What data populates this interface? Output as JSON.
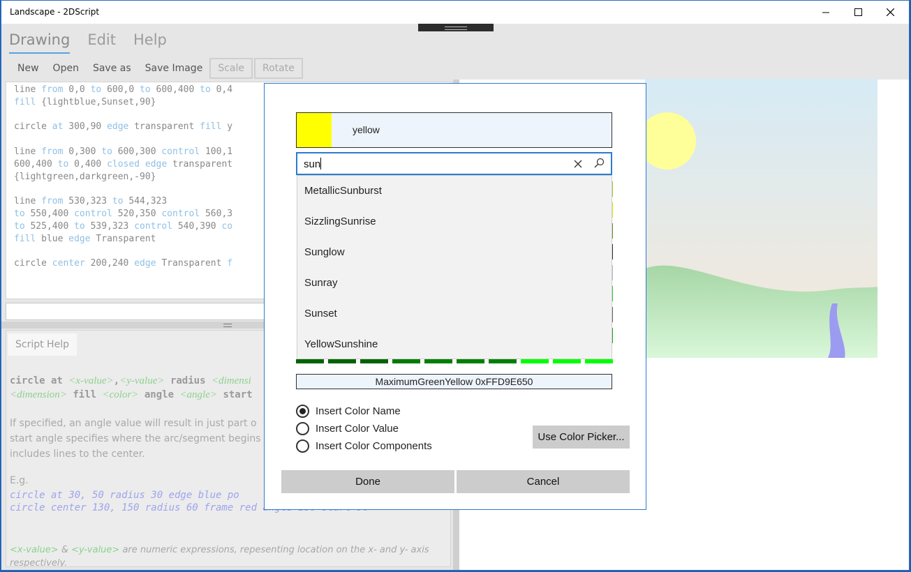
{
  "window": {
    "title": "Landscape - 2DScript"
  },
  "menu_tabs": [
    {
      "label": "Drawing",
      "active": true
    },
    {
      "label": "Edit",
      "active": false
    },
    {
      "label": "Help",
      "active": false
    }
  ],
  "toolbar": {
    "new": "New",
    "open": "Open",
    "save_as": "Save as",
    "save_image": "Save Image",
    "scale": "Scale",
    "rotate": "Rotate"
  },
  "editor": {
    "line1a": "line ",
    "line1b": "from",
    "line1c": " 0,0 ",
    "line1d": "to",
    "line1e": " 600,0 ",
    "line1f": "to",
    "line1g": " 600,400 ",
    "line1h": "to",
    "line1i": " 0,4",
    "line2a": "fill",
    "line2b": " {lightblue,Sunset,90}",
    "line3a": "circle ",
    "line3b": "at",
    "line3c": " 300,90 ",
    "line3d": "edge",
    "line3e": " transparent ",
    "line3f": "fill",
    "line3g": " y",
    "line4a": "line ",
    "line4b": "from",
    "line4c": " 0,300 ",
    "line4d": "to",
    "line4e": " 600,300 ",
    "line4f": "control",
    "line4g": " 100,1",
    "line5a": "600,400 ",
    "line5b": "to",
    "line5c": " 0,400 ",
    "line5d": "closed",
    "line5e": " ",
    "line5f": "edge",
    "line5g": " transparent",
    "line6": "{lightgreen,darkgreen,-90}",
    "line7a": "line ",
    "line7b": "from",
    "line7c": " 530,323 ",
    "line7d": "to",
    "line7e": " 544,323",
    "line8a": "to",
    "line8b": " 550,400 ",
    "line8c": "control",
    "line8d": " 520,350 ",
    "line8e": "control",
    "line8f": " 560,3",
    "line9a": "to",
    "line9b": " 525,400 ",
    "line9c": "to",
    "line9d": " 539,323 ",
    "line9e": "control",
    "line9f": " 540,390 ",
    "line9g": "co",
    "line10a": "fill",
    "line10b": " blue ",
    "line10c": "edge",
    "line10d": " Transparent",
    "line11a": "circle ",
    "line11b": "center",
    "line11c": " 200,240 ",
    "line11d": "edge",
    "line11e": " Transparent ",
    "line11f": "f"
  },
  "help": {
    "tab_label": "Script Help",
    "syntax1a": "circle at ",
    "syntax1b": "<x-value>",
    "syntax1c": ",",
    "syntax1d": "<y-value>",
    "syntax1e": " radius ",
    "syntax1f": "<dimensi",
    "syntax2a": "<dimension>",
    "syntax2b": " fill ",
    "syntax2c": "<color>",
    "syntax2d": " angle ",
    "syntax2e": "<angle>",
    "syntax2f": " start",
    "para1": "If specified, an angle value will result in  just part o",
    "para2": "start angle specifies where the arc/segment begins",
    "para3": "includes lines to the center.",
    "eg_label": "E.g.",
    "code1": "circle at 30, 50 radius 30 edge blue po",
    "code2": "circle center 130, 150 radius 60 frame red angle 180 start 90",
    "foot_a": "<x-value>",
    "foot_b": " & ",
    "foot_c": "<y-value>",
    "foot_d": " are numeric expressions, repesenting location on the x- and y- axis respectively."
  },
  "dialog": {
    "selected_color_name": "yellow",
    "selected_color": "#ffff00",
    "search_value": "sun",
    "suggestions": [
      "MetallicSunburst",
      "SizzlingSunrise",
      "Sunglow",
      "Sunray",
      "Sunset",
      "YellowSunshine"
    ],
    "hover_info": "MaximumGreenYellow 0xFFD9E650",
    "options": [
      {
        "label": "Insert Color Name",
        "selected": true
      },
      {
        "label": "Insert Color Value",
        "selected": false
      },
      {
        "label": "Insert Color Components",
        "selected": false
      }
    ],
    "color_picker_button": "Use Color Picker...",
    "done_button": "Done",
    "cancel_button": "Cancel",
    "swatch_colors": [
      "#006400",
      "#006400",
      "#006400",
      "#007a00",
      "#007f00",
      "#008000",
      "#008000",
      "#00ff00",
      "#00ff00",
      "#00ff00"
    ]
  },
  "colors": {
    "accent": "#2b7bd1",
    "sky_top": "#d6ebf5",
    "sky_bottom": "#f7e8d8",
    "sun": "#ffff99",
    "hill_top": "#a6d6a6",
    "hill_bottom": "#d9f7d9",
    "river": "#9b9bf2"
  }
}
